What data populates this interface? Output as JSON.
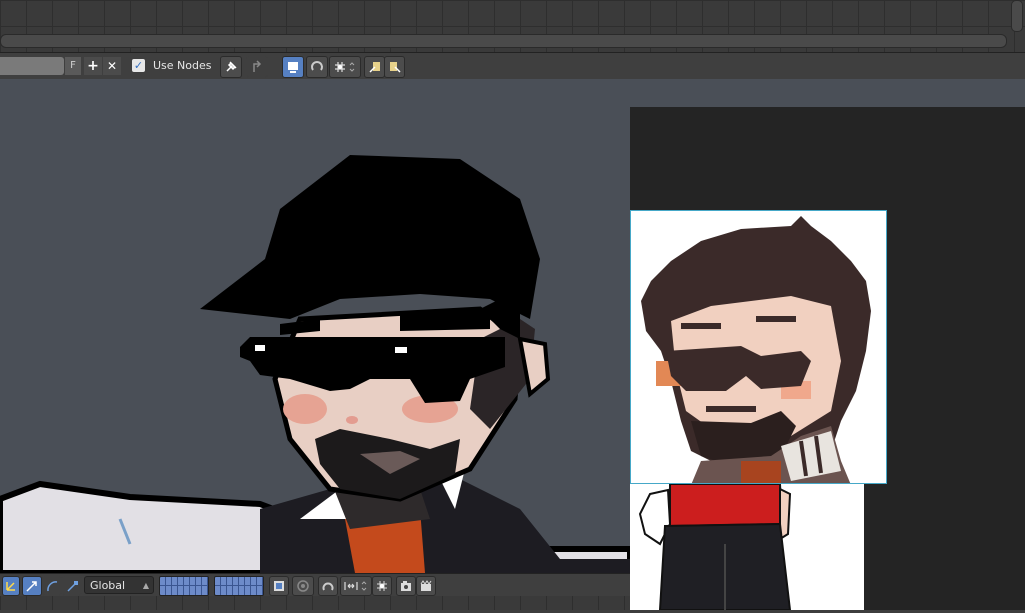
{
  "header": {
    "f_label": "F",
    "add_label": "+",
    "close_label": "✕",
    "checkbox_mark": "✓",
    "use_nodes_label": "Use Nodes"
  },
  "bottom": {
    "orientation_value": "Global"
  },
  "colors": {
    "accent": "#5680c2",
    "viewport_bg": "#4a4f57",
    "texture_border": "#45a8c8"
  }
}
